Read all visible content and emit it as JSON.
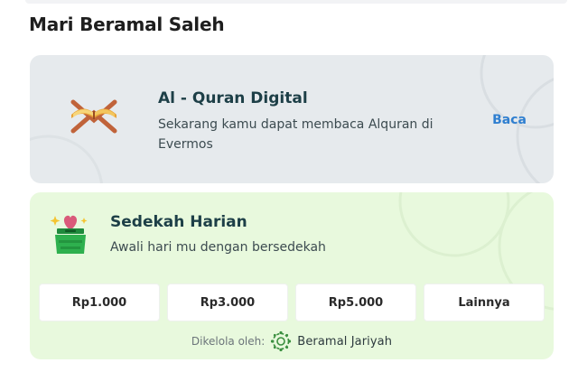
{
  "section": {
    "title": "Mari Beramal Saleh"
  },
  "quran_card": {
    "icon": "open-quran-book-icon",
    "title": "Al - Quran Digital",
    "description": "Sekarang kamu dapat membaca Alquran di Evermos",
    "action_label": "Baca",
    "action_color": "#2f7fd0",
    "background": "#e6eaed"
  },
  "sedekah_card": {
    "icon": "donation-box-heart-icon",
    "title": "Sedekah Harian",
    "subtitle": "Awali hari mu dengan bersedekah",
    "background": "#e8f9dd",
    "amounts": [
      {
        "label": "Rp1.000"
      },
      {
        "label": "Rp3.000"
      },
      {
        "label": "Rp5.000"
      },
      {
        "label": "Lainnya"
      }
    ],
    "managed_by_label": "Dikelola oleh:",
    "managed_by_logo": "beramal-jariyah-logo-icon",
    "managed_by_name": "Beramal Jariyah"
  }
}
